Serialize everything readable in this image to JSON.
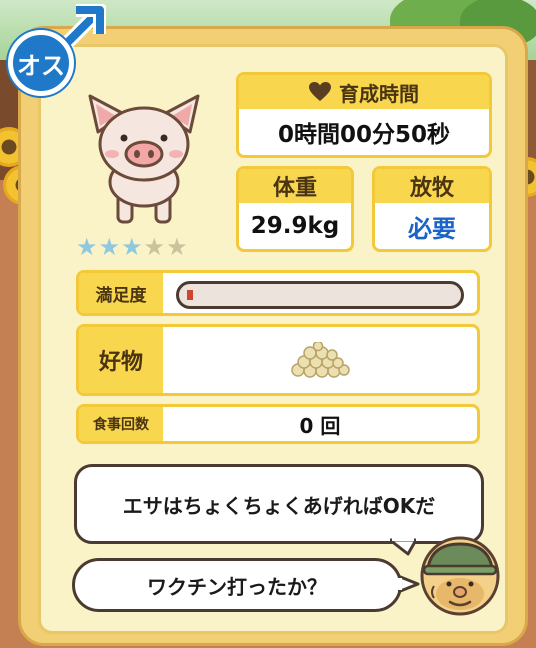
{
  "gender": {
    "label": "オス"
  },
  "stars": {
    "filled": 3,
    "total": 5
  },
  "growth": {
    "label": "育成時間",
    "value": "0時間00分50秒"
  },
  "weight": {
    "label": "体重",
    "value": "29.9kg"
  },
  "grazing": {
    "label": "放牧",
    "value": "必要"
  },
  "satisfaction": {
    "label": "満足度",
    "level": 0.02
  },
  "favorite": {
    "label": "好物",
    "item_icon": "feed-pile-icon"
  },
  "meals": {
    "label": "食事回数",
    "value": "0 回"
  },
  "speech": {
    "line1": "エサはちょくちょくあげればOKだ",
    "line2": "ワクチン打ったか？"
  },
  "colors": {
    "accent": "#f8d64e",
    "gender_blue": "#1f78c8",
    "grazing_text": "#1a64c8",
    "meter_fill": "#d0452d"
  }
}
